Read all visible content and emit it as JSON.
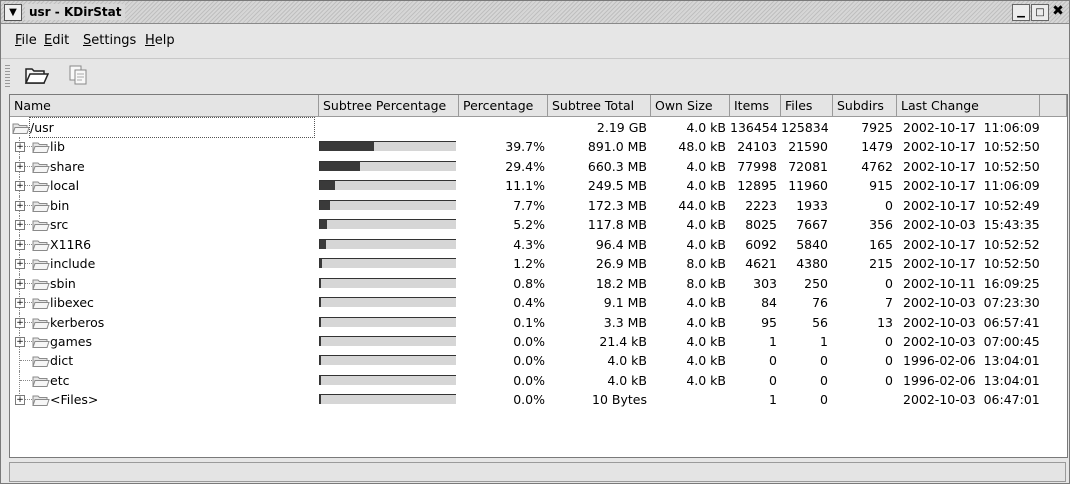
{
  "window": {
    "title": "usr - KDirStat"
  },
  "menubar": {
    "items": [
      {
        "pre": "",
        "accel": "F",
        "rest": "ile"
      },
      {
        "pre": "",
        "accel": "E",
        "rest": "dit"
      },
      {
        "pre": "",
        "accel": "S",
        "rest": "ettings"
      },
      {
        "pre": "",
        "accel": "H",
        "rest": "elp"
      }
    ]
  },
  "toolbar": {
    "buttons": [
      "open-folder-icon",
      "copy-icon"
    ]
  },
  "columns": [
    "Name",
    "Subtree Percentage",
    "Percentage",
    "Subtree Total",
    "Own Size",
    "Items",
    "Files",
    "Subdirs",
    "Last Change"
  ],
  "rows": [
    {
      "name": "/usr",
      "expander": "",
      "fill": null,
      "percentage": "",
      "subtree_total": "2.19 GB",
      "own_size": "4.0 kB",
      "items": "136454",
      "files": "125834",
      "subdirs": "7925",
      "last_change": "2002-10-17  11:06:09"
    },
    {
      "name": "lib",
      "expander": "+",
      "fill": 0.397,
      "percentage": "39.7%",
      "subtree_total": "891.0 MB",
      "own_size": "48.0 kB",
      "items": "24103",
      "files": "21590",
      "subdirs": "1479",
      "last_change": "2002-10-17  10:52:50"
    },
    {
      "name": "share",
      "expander": "+",
      "fill": 0.294,
      "percentage": "29.4%",
      "subtree_total": "660.3 MB",
      "own_size": "4.0 kB",
      "items": "77998",
      "files": "72081",
      "subdirs": "4762",
      "last_change": "2002-10-17  10:52:50"
    },
    {
      "name": "local",
      "expander": "+",
      "fill": 0.111,
      "percentage": "11.1%",
      "subtree_total": "249.5 MB",
      "own_size": "4.0 kB",
      "items": "12895",
      "files": "11960",
      "subdirs": "915",
      "last_change": "2002-10-17  11:06:09"
    },
    {
      "name": "bin",
      "expander": "+",
      "fill": 0.077,
      "percentage": "7.7%",
      "subtree_total": "172.3 MB",
      "own_size": "44.0 kB",
      "items": "2223",
      "files": "1933",
      "subdirs": "0",
      "last_change": "2002-10-17  10:52:49"
    },
    {
      "name": "src",
      "expander": "+",
      "fill": 0.052,
      "percentage": "5.2%",
      "subtree_total": "117.8 MB",
      "own_size": "4.0 kB",
      "items": "8025",
      "files": "7667",
      "subdirs": "356",
      "last_change": "2002-10-03  15:43:35"
    },
    {
      "name": "X11R6",
      "expander": "+",
      "fill": 0.043,
      "percentage": "4.3%",
      "subtree_total": "96.4 MB",
      "own_size": "4.0 kB",
      "items": "6092",
      "files": "5840",
      "subdirs": "165",
      "last_change": "2002-10-17  10:52:52"
    },
    {
      "name": "include",
      "expander": "+",
      "fill": 0.012,
      "percentage": "1.2%",
      "subtree_total": "26.9 MB",
      "own_size": "8.0 kB",
      "items": "4621",
      "files": "4380",
      "subdirs": "215",
      "last_change": "2002-10-17  10:52:50"
    },
    {
      "name": "sbin",
      "expander": "+",
      "fill": 0.008,
      "percentage": "0.8%",
      "subtree_total": "18.2 MB",
      "own_size": "8.0 kB",
      "items": "303",
      "files": "250",
      "subdirs": "0",
      "last_change": "2002-10-11  16:09:25"
    },
    {
      "name": "libexec",
      "expander": "+",
      "fill": 0.004,
      "percentage": "0.4%",
      "subtree_total": "9.1 MB",
      "own_size": "4.0 kB",
      "items": "84",
      "files": "76",
      "subdirs": "7",
      "last_change": "2002-10-03  07:23:30"
    },
    {
      "name": "kerberos",
      "expander": "+",
      "fill": 0.001,
      "percentage": "0.1%",
      "subtree_total": "3.3 MB",
      "own_size": "4.0 kB",
      "items": "95",
      "files": "56",
      "subdirs": "13",
      "last_change": "2002-10-03  06:57:41"
    },
    {
      "name": "games",
      "expander": "+",
      "fill": 0.0,
      "percentage": "0.0%",
      "subtree_total": "21.4 kB",
      "own_size": "4.0 kB",
      "items": "1",
      "files": "1",
      "subdirs": "0",
      "last_change": "2002-10-03  07:00:45"
    },
    {
      "name": "dict",
      "expander": "",
      "fill": 0.0,
      "percentage": "0.0%",
      "subtree_total": "4.0 kB",
      "own_size": "4.0 kB",
      "items": "0",
      "files": "0",
      "subdirs": "0",
      "last_change": "1996-02-06  13:04:01"
    },
    {
      "name": "etc",
      "expander": "",
      "fill": 0.0,
      "percentage": "0.0%",
      "subtree_total": "4.0 kB",
      "own_size": "4.0 kB",
      "items": "0",
      "files": "0",
      "subdirs": "0",
      "last_change": "1996-02-06  13:04:01"
    },
    {
      "name": "<Files>",
      "expander": "+",
      "fill": 0.0,
      "percentage": "0.0%",
      "subtree_total": "10 Bytes",
      "own_size": "",
      "items": "1",
      "files": "0",
      "subdirs": "",
      "last_change": "2002-10-03  06:47:01"
    }
  ],
  "statusbar": {
    "text": ""
  }
}
